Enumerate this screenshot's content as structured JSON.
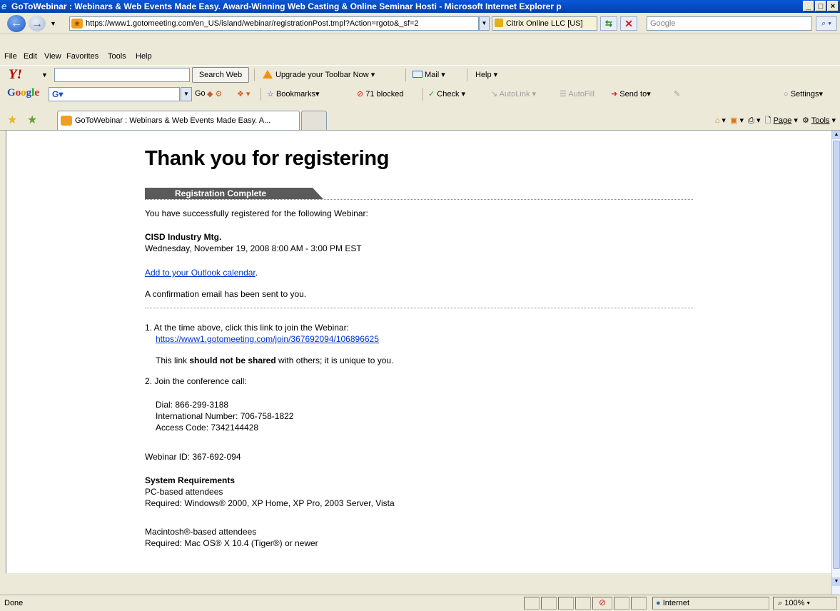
{
  "window": {
    "title": "GoToWebinar : Webinars & Web Events Made Easy. Award-Winning Web Casting & Online Seminar Hosti - Microsoft Internet Explorer p",
    "controls": [
      "_",
      "□",
      "×"
    ]
  },
  "address_bar": {
    "url": "https://www1.gotomeeting.com/en_US/island/webinar/registrationPost.tmpl?Action=rgoto&_sf=2",
    "certificate": "Citrix Online LLC [US]",
    "search_placeholder": "Google"
  },
  "menu": [
    "File",
    "Edit",
    "View",
    "Favorites",
    "Tools",
    "Help"
  ],
  "yahoo_toolbar": {
    "logo": "Y!",
    "search_button": "Search Web",
    "upgrade": "Upgrade your Toolbar Now",
    "mail": "Mail",
    "help": "Help"
  },
  "google_toolbar": {
    "logo": "Google",
    "field": "G",
    "go": "Go",
    "bookmarks": "Bookmarks",
    "blocked": "71 blocked",
    "check": "Check",
    "autolink": "AutoLink",
    "autofill": "AutoFill",
    "sendto": "Send to",
    "settings": "Settings"
  },
  "tabs": {
    "active_label": "GoToWebinar : Webinars & Web Events Made Easy. A...",
    "page": "Page",
    "tools": "Tools"
  },
  "page": {
    "title": "Thank you for registering",
    "band": "Registration Complete",
    "intro": "You have successfully registered for the following Webinar:",
    "webinar_name": "CISD Industry Mtg.",
    "webinar_time": "Wednesday, November 19, 2008 8:00 AM - 3:00 PM EST",
    "outlook_link": "Add to your Outlook calendar",
    "outlook_suffix": ".",
    "confirmation": "A confirmation email has been sent to you.",
    "step1": "1. At the time above, click this link to join the Webinar:",
    "join_link": "https://www1.gotomeeting.com/join/367692094/106896625",
    "share_pre": "This link ",
    "share_bold": "should not be shared",
    "share_post": " with others; it is unique to you.",
    "step2": "2. Join the conference call:",
    "dial": "Dial: 866-299-3188",
    "intl": "International Number: 706-758-1822",
    "access": "Access Code: 7342144428",
    "webinar_id": "Webinar ID: 367-692-094",
    "sysreq_title": "System Requirements",
    "pc_label": "PC-based attendees",
    "pc_req": "Required: Windows® 2000, XP Home, XP Pro, 2003 Server, Vista",
    "mac_label": "Macintosh®-based attendees",
    "mac_req": "Required: Mac OS® X 10.4 (Tiger®) or newer"
  },
  "status": {
    "text": "Done",
    "zone": "Internet",
    "zoom": "100%"
  }
}
